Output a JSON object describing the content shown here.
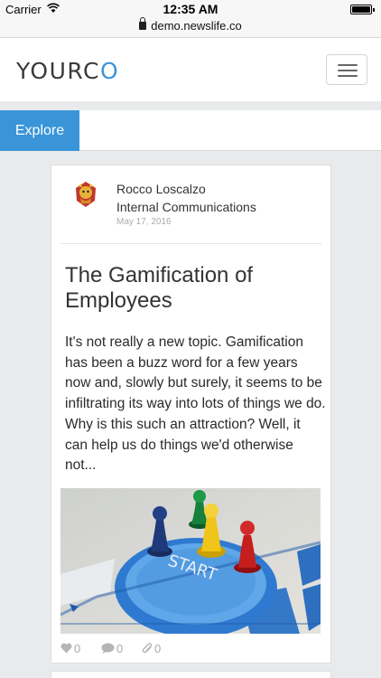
{
  "status_bar": {
    "carrier": "Carrier",
    "time": "12:35 AM",
    "url": "demo.newslife.co"
  },
  "header": {
    "logo_main": "YOURC",
    "logo_accent": "O"
  },
  "nav": {
    "tabs": [
      {
        "label": "Explore",
        "active": true
      }
    ]
  },
  "article": {
    "author": "Rocco Loscalzo",
    "department": "Internal Communications",
    "date": "May 17, 2016",
    "title": "The Gamification of Employees",
    "excerpt": "It's not really a new topic.  Gamification has been a buzz word for a few years now and, slowly but surely, it seems to be infiltrating its way into lots of things we do. Why is this such an attraction? Well, it can help us do things we'd otherwise not...",
    "likes": "0",
    "comments": "0",
    "attachments": "0"
  },
  "colors": {
    "accent": "#3a95d8",
    "background": "#e8eaec"
  }
}
